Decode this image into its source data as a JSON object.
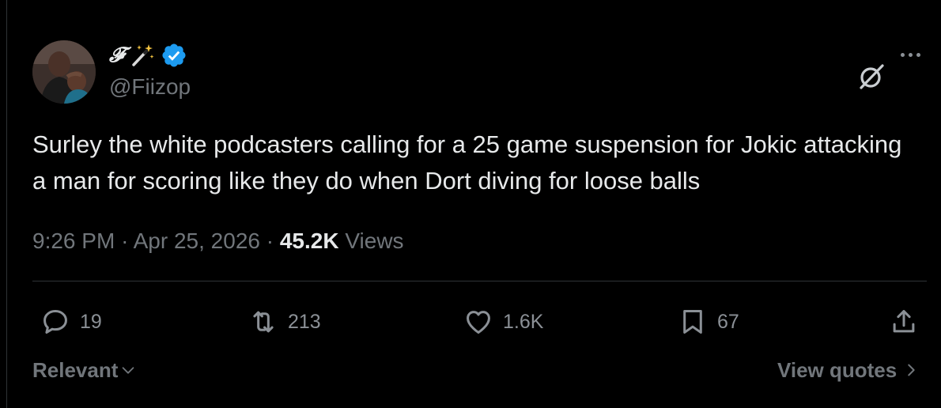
{
  "post": {
    "author": {
      "display_name": "𝓕",
      "handle": "@Fiizop",
      "verified": true,
      "avatar_icon": "avatar-photo",
      "name_icons": [
        "magic-wand-icon",
        "verified-badge-icon"
      ]
    },
    "text": "Surley the white podcasters calling for a 25 game suspension for Jokic attacking a man for scoring like they do when Dort diving for loose balls",
    "time": "9:26 PM",
    "separator": "·",
    "date": "Apr 25, 2026",
    "views_count": "45.2K",
    "views_label": "Views"
  },
  "actions": {
    "replies": "19",
    "reposts": "213",
    "likes": "1.6K",
    "bookmarks": "67"
  },
  "footer": {
    "sort_label": "Relevant",
    "quotes_label": "View quotes"
  },
  "colors": {
    "background": "#000000",
    "text_primary": "#e7e9ea",
    "text_secondary": "#71767b",
    "divider": "#2f3336",
    "verified_blue": "#1d9bf0"
  }
}
